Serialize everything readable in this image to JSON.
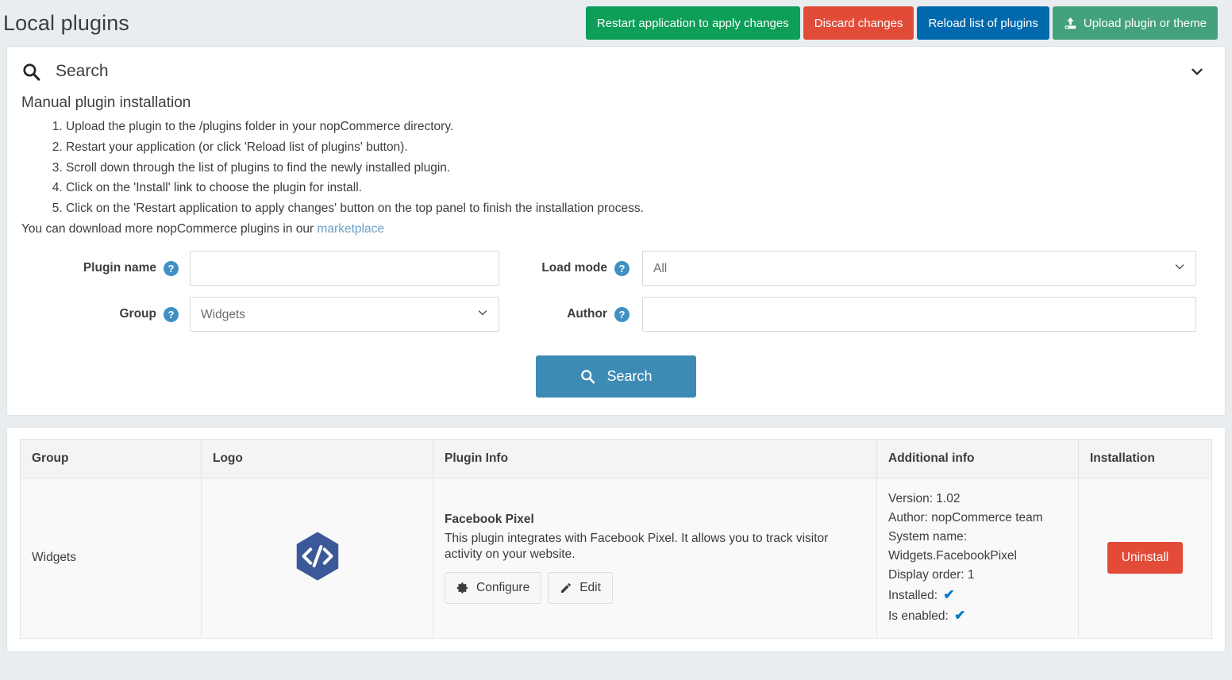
{
  "header": {
    "title": "Local plugins",
    "buttons": [
      {
        "label": "Restart application to apply changes",
        "name": "restart-application-button",
        "style": "btn-restart",
        "icon": ""
      },
      {
        "label": "Discard changes",
        "name": "discard-changes-button",
        "style": "btn-discard",
        "icon": ""
      },
      {
        "label": "Reload list of plugins",
        "name": "reload-plugins-button",
        "style": "btn-reload",
        "icon": ""
      },
      {
        "label": "Upload plugin or theme",
        "name": "upload-plugin-button",
        "style": "btn-upload",
        "icon": "upload-icon"
      }
    ]
  },
  "search_panel": {
    "title": "Search",
    "icon": "search-icon",
    "collapse_icon": "chevron-down-icon",
    "manual_title": "Manual plugin installation",
    "instructions": [
      "Upload the plugin to the /plugins folder in your nopCommerce directory.",
      "Restart your application (or click 'Reload list of plugins' button).",
      "Scroll down through the list of plugins to find the newly installed plugin.",
      "Click on the 'Install' link to choose the plugin for install.",
      "Click on the 'Restart application to apply changes' button on the top panel to finish the installation process."
    ],
    "marketplace_text": "You can download more nopCommerce plugins in our ",
    "marketplace_link": "marketplace",
    "fields": {
      "plugin_name": {
        "label": "Plugin name",
        "value": "",
        "placeholder": "",
        "help": "?"
      },
      "group": {
        "label": "Group",
        "value": "Widgets",
        "help": "?",
        "options": [
          "Widgets"
        ]
      },
      "load_mode": {
        "label": "Load mode",
        "value": "All",
        "help": "?",
        "options": [
          "All"
        ]
      },
      "author": {
        "label": "Author",
        "value": "",
        "placeholder": "",
        "help": "?"
      }
    },
    "search_button": {
      "label": "Search",
      "icon": "search-icon"
    }
  },
  "table": {
    "columns": [
      "Group",
      "Logo",
      "Plugin Info",
      "Additional info",
      "Installation"
    ],
    "rows": [
      {
        "group": "Widgets",
        "logo_icon": "code-hexagon-icon",
        "plugin_name": "Facebook Pixel",
        "plugin_description": "This plugin integrates with Facebook Pixel. It allows you to track visitor activity on your website.",
        "actions": [
          {
            "label": "Configure",
            "icon": "gear-icon",
            "name": "configure-button"
          },
          {
            "label": "Edit",
            "icon": "pencil-icon",
            "name": "edit-button"
          }
        ],
        "additional_info": [
          "Version: 1.02",
          "Author: nopCommerce team",
          "System name:",
          "Widgets.FacebookPixel",
          "Display order: 1"
        ],
        "installed_label": "Installed:",
        "installed_check": "✔",
        "enabled_label": "Is enabled:",
        "enabled_check": "✔",
        "installation_button": "Uninstall"
      }
    ]
  },
  "colors": {
    "green": "#0d9e57",
    "red": "#e14b38",
    "blue": "#0069ad",
    "seagreen": "#43a17b",
    "search_blue": "#3d8ab5",
    "help_blue": "#4090c4",
    "check_blue": "#0078c8",
    "logo_hex": "#3b5998",
    "page_bg": "#e9edf0"
  }
}
